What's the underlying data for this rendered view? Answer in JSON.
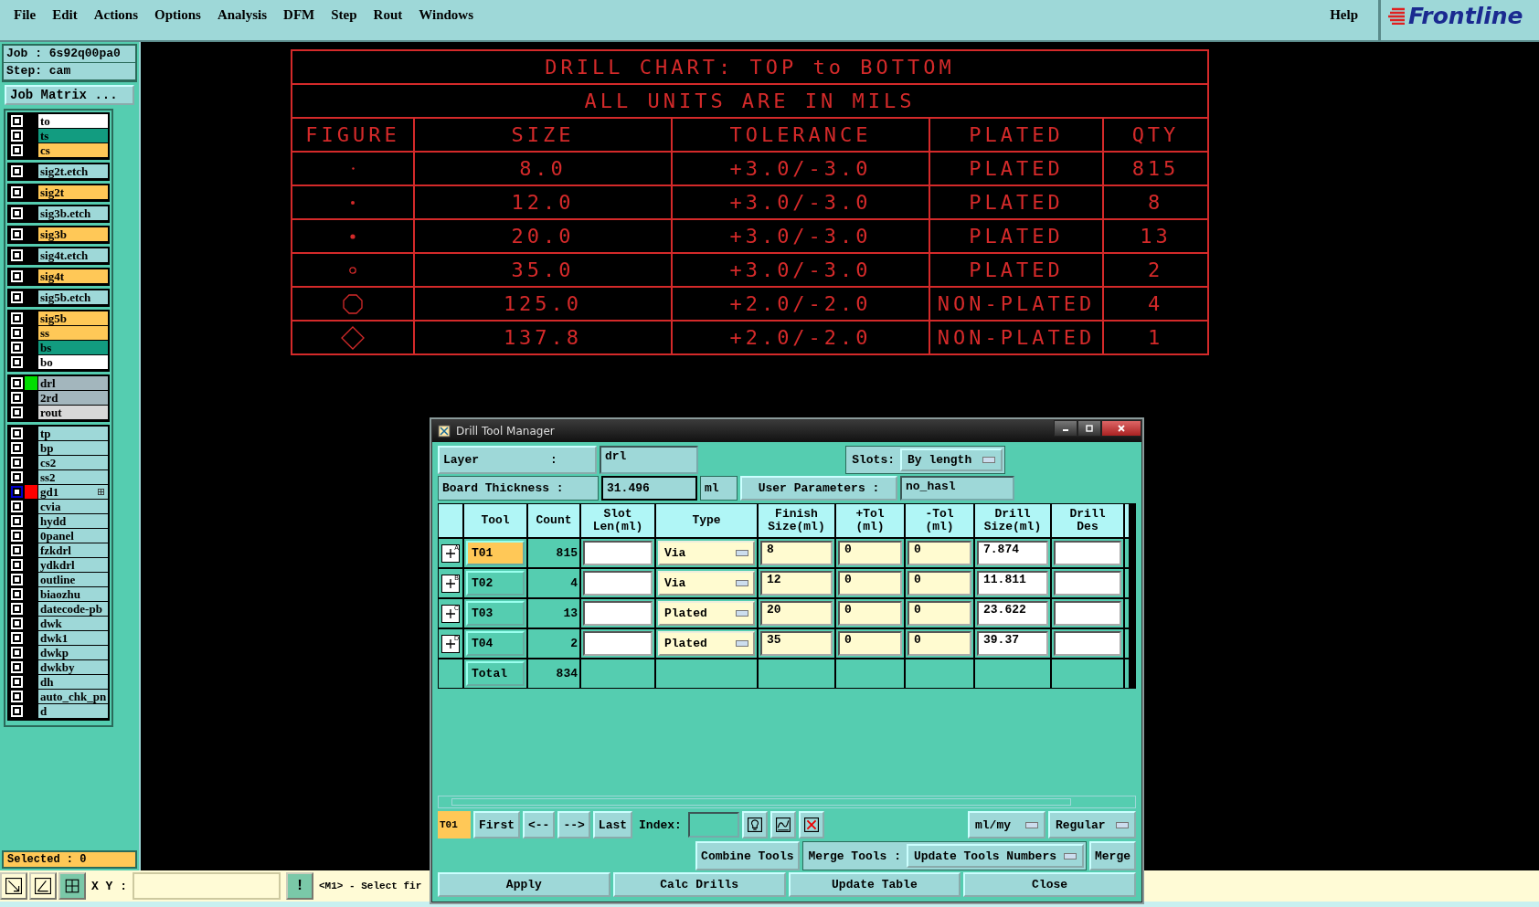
{
  "menu": [
    "File",
    "Edit",
    "Actions",
    "Options",
    "Analysis",
    "DFM",
    "Step",
    "Rout",
    "Windows"
  ],
  "help": "Help",
  "logo": "Frontline",
  "job": {
    "job": "Job : 6s92q00pa0",
    "step": "Step: cam",
    "matrix_button": "Job Matrix ..."
  },
  "layer_groups": [
    {
      "layers": [
        {
          "name": "to",
          "color": "#ffffff",
          "checked": false
        },
        {
          "name": "ts",
          "color": "#129c80",
          "checked": false
        },
        {
          "name": "cs",
          "color": "#ffc857",
          "checked": false
        }
      ]
    },
    {
      "layers": [
        {
          "name": "sig2t.etch",
          "color": "#9ed8d8",
          "checked": false
        }
      ]
    },
    {
      "layers": [
        {
          "name": "sig2t",
          "color": "#ffc857",
          "checked": false
        }
      ]
    },
    {
      "layers": [
        {
          "name": "sig3b.etch",
          "color": "#9ed8d8",
          "checked": false
        }
      ]
    },
    {
      "layers": [
        {
          "name": "sig3b",
          "color": "#ffc857",
          "checked": false
        }
      ]
    },
    {
      "layers": [
        {
          "name": "sig4t.etch",
          "color": "#9ed8d8",
          "checked": false
        }
      ]
    },
    {
      "layers": [
        {
          "name": "sig4t",
          "color": "#ffc857",
          "checked": false
        }
      ]
    },
    {
      "layers": [
        {
          "name": "sig5b.etch",
          "color": "#9ed8d8",
          "checked": false
        }
      ]
    },
    {
      "layers": [
        {
          "name": "sig5b",
          "color": "#ffc857",
          "checked": false
        },
        {
          "name": "ss",
          "color": "#ffc857",
          "checked": false
        },
        {
          "name": "bs",
          "color": "#129c80",
          "checked": false
        },
        {
          "name": "bo",
          "color": "#ffffff",
          "checked": false
        }
      ]
    },
    {
      "layers": [
        {
          "name": "drl",
          "color": "#a3b6bd",
          "checked": false,
          "work_layer": true
        },
        {
          "name": "2rd",
          "color": "#a3b6bd",
          "checked": false
        },
        {
          "name": "rout",
          "color": "#d8d8d8",
          "checked": false
        }
      ]
    },
    {
      "layers": [
        {
          "name": "tp",
          "color": "#9ed8d8",
          "checked": false
        },
        {
          "name": "bp",
          "color": "#9ed8d8",
          "checked": false
        },
        {
          "name": "cs2",
          "color": "#9ed8d8",
          "checked": false
        },
        {
          "name": "ss2",
          "color": "#9ed8d8",
          "checked": false
        },
        {
          "name": "gd1",
          "color": "#9ed8d8",
          "checked": false,
          "affected": true
        },
        {
          "name": "cvia",
          "color": "#9ed8d8",
          "checked": false
        },
        {
          "name": "hydd",
          "color": "#9ed8d8",
          "checked": false
        },
        {
          "name": "0panel",
          "color": "#9ed8d8",
          "checked": false
        },
        {
          "name": "fzkdrl",
          "color": "#9ed8d8",
          "checked": false
        },
        {
          "name": "ydkdrl",
          "color": "#9ed8d8",
          "checked": false
        },
        {
          "name": "outline",
          "color": "#9ed8d8",
          "checked": false
        },
        {
          "name": "biaozhu",
          "color": "#9ed8d8",
          "checked": false
        },
        {
          "name": "datecode-pb",
          "color": "#9ed8d8",
          "checked": false
        },
        {
          "name": "dwk",
          "color": "#9ed8d8",
          "checked": false
        },
        {
          "name": "dwk1",
          "color": "#9ed8d8",
          "checked": false
        },
        {
          "name": "dwkp",
          "color": "#9ed8d8",
          "checked": false
        },
        {
          "name": "dwkby",
          "color": "#9ed8d8",
          "checked": false
        },
        {
          "name": "dh",
          "color": "#9ed8d8",
          "checked": false
        },
        {
          "name": "auto_chk_pn",
          "color": "#9ed8d8",
          "checked": false
        },
        {
          "name": "d",
          "color": "#9ed8d8",
          "checked": false
        }
      ]
    }
  ],
  "selected_count": "Selected : 0",
  "status_bar": {
    "xy_label": "X Y :",
    "warning_button": "!",
    "prompt": "<M1> - Select fir"
  },
  "drill_chart": {
    "title": "DRILL CHART: TOP to BOTTOM",
    "units": "ALL UNITS ARE IN MILS",
    "columns": [
      "FIGURE",
      "SIZE",
      "TOLERANCE",
      "PLATED",
      "QTY"
    ],
    "rows": [
      {
        "kind": "dot-small",
        "size": "8.0",
        "tolerance": "+3.0/-3.0",
        "plated": "PLATED",
        "qty": "815"
      },
      {
        "kind": "dot",
        "size": "12.0",
        "tolerance": "+3.0/-3.0",
        "plated": "PLATED",
        "qty": "8"
      },
      {
        "kind": "dot-large",
        "size": "20.0",
        "tolerance": "+3.0/-3.0",
        "plated": "PLATED",
        "qty": "13"
      },
      {
        "kind": "ring",
        "size": "35.0",
        "tolerance": "+3.0/-3.0",
        "plated": "PLATED",
        "qty": "2"
      },
      {
        "kind": "octagon",
        "size": "125.0",
        "tolerance": "+2.0/-2.0",
        "plated": "NON-PLATED",
        "qty": "4"
      },
      {
        "kind": "diamond",
        "size": "137.8",
        "tolerance": "+2.0/-2.0",
        "plated": "NON-PLATED",
        "qty": "1"
      }
    ]
  },
  "dialog": {
    "title": "Drill Tool Manager",
    "layer_label": "Layer          :",
    "layer": "drl",
    "slots_label": "Slots:",
    "slots": "By length",
    "thickness_label": "Board Thickness :",
    "thickness": "31.496",
    "thickness_unit": "ml",
    "user_params_button": "User Parameters :",
    "user_params": "no_hasl",
    "columns": [
      "Tool",
      "Count",
      "Slot\nLen(ml)",
      "Type",
      "Finish\nSize(ml)",
      "+Tol\n(ml)",
      "-Tol\n(ml)",
      "Drill\nSize(ml)",
      "Drill\nDes"
    ],
    "rows": [
      {
        "marker": "A",
        "tool": "T01",
        "selected": true,
        "count": "815",
        "type": "Via",
        "finish": "8",
        "plus_tol": "0",
        "minus_tol": "0",
        "drill_size": "7.874"
      },
      {
        "marker": "B",
        "tool": "T02",
        "selected": false,
        "count": "4",
        "type": "Via",
        "finish": "12",
        "plus_tol": "0",
        "minus_tol": "0",
        "drill_size": "11.811"
      },
      {
        "marker": "C",
        "tool": "T03",
        "selected": false,
        "count": "13",
        "type": "Plated",
        "finish": "20",
        "plus_tol": "0",
        "minus_tol": "0",
        "drill_size": "23.622"
      },
      {
        "marker": "D",
        "tool": "T04",
        "selected": false,
        "count": "2",
        "type": "Plated",
        "finish": "35",
        "plus_tol": "0",
        "minus_tol": "0",
        "drill_size": "39.37"
      }
    ],
    "total": {
      "label": "Total",
      "count": "834"
    },
    "current_tool": "T01",
    "nav": [
      "First",
      "<--",
      "-->",
      "Last"
    ],
    "index_label": "Index:",
    "units": "ml/my",
    "mode": "Regular",
    "combine_button": "Combine Tools",
    "merge_label": "Merge Tools :",
    "merge_option": "Update Tools Numbers",
    "merge_button": "Merge",
    "actions": [
      "Apply",
      "Calc Drills",
      "Update Table",
      "Close"
    ]
  }
}
